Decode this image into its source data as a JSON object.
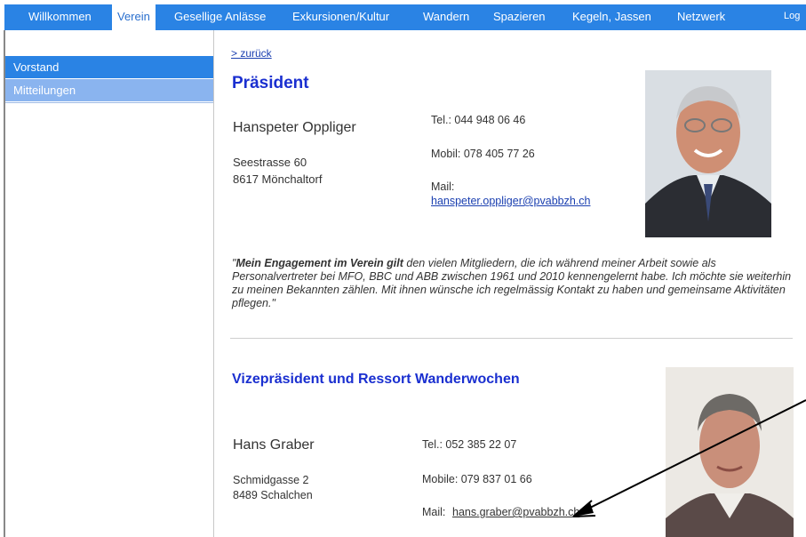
{
  "nav": {
    "items": [
      {
        "label": "Willkommen"
      },
      {
        "label": "Verein"
      },
      {
        "label": "Gesellige Anlässe"
      },
      {
        "label": "Exkursionen/Kultur"
      },
      {
        "label": "Wandern"
      },
      {
        "label": "Spazieren"
      },
      {
        "label": "Kegeln, Jassen"
      },
      {
        "label": "Netzwerk"
      },
      {
        "label": "Log"
      }
    ]
  },
  "sidebar": {
    "items": [
      {
        "label": "Vorstand"
      },
      {
        "label": "Mitteilungen"
      }
    ]
  },
  "main": {
    "back_link": "> zurück",
    "president": {
      "heading": "Präsident",
      "name": "Hanspeter Oppliger",
      "street": "Seestrasse 60",
      "city": "8617 Mönchaltorf",
      "tel": "Tel.: 044 948 06 46",
      "mobile": "Mobil: 078 405 77 26",
      "mail_label": "Mail:",
      "mail": "hanspeter.oppliger@pvabbzh.ch",
      "quote_bold": "Mein Engagement im Verein gilt",
      "quote_rest": " den vielen Mitgliedern, die ich während meiner Arbeit sowie als Personalvertreter bei MFO, BBC und ABB zwischen 1961 und 2010 kennengelernt habe. Ich möchte sie weiterhin zu meinen Bekannten zählen. Mit ihnen wünsche ich regelmässig Kontakt zu haben und gemeinsame Aktivitäten pflegen."
    },
    "vice": {
      "heading": "Vizepräsident und Ressort Wanderwochen",
      "name": "Hans Graber",
      "street": "Schmidgasse 2",
      "city": "8489 Schalchen",
      "tel": "Tel.: 052 385 22 07",
      "mobile": "Mobile: 079 837 01 66",
      "mail_label": "Mail:",
      "mail": "hans.graber@pvabbzh.ch"
    }
  },
  "colors": {
    "nav_bg": "#2a83e4",
    "sidebar_active": "#2a83e4",
    "sidebar_item": "#8ab4ef",
    "heading": "#1a2fd0",
    "link": "#1a3fb0"
  }
}
